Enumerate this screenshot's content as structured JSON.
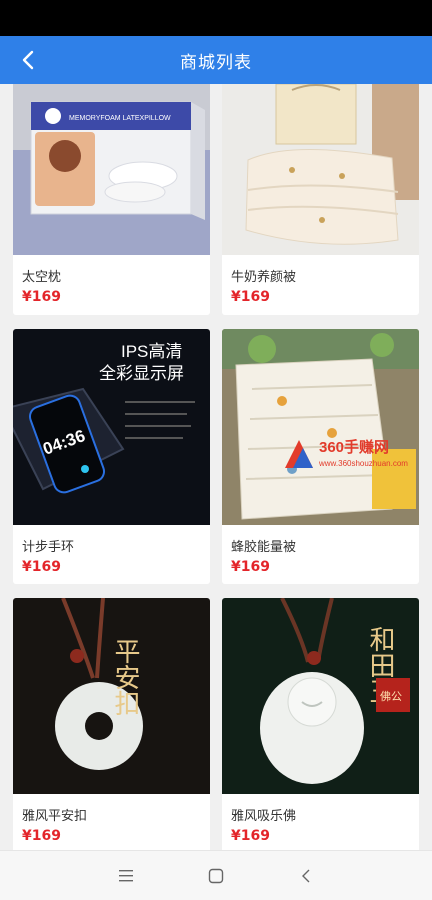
{
  "header": {
    "title": "商城列表"
  },
  "products": [
    {
      "name": "太空枕",
      "price": "¥169"
    },
    {
      "name": "牛奶养颜被",
      "price": "¥169"
    },
    {
      "name": "计步手环",
      "price": "¥169"
    },
    {
      "name": "蜂胶能量被",
      "price": "¥169"
    },
    {
      "name": "雅风平安扣",
      "price": "¥169"
    },
    {
      "name": "雅风吸乐佛",
      "price": "¥169"
    }
  ],
  "images": {
    "pillow_box": {
      "brand": "MEMORYFOAM LATEXPILLOW"
    },
    "band": {
      "headline1": "IPS高清",
      "headline2": "全彩显示屏",
      "time": "04:36"
    },
    "jade1": {
      "chars": "平安扣"
    },
    "jade2": {
      "chars": "和田玉",
      "seal": "佛公"
    }
  },
  "watermark": {
    "text": "360手赚网",
    "url": "www.360shouzhuan.com"
  },
  "colors": {
    "header": "#2f80e8",
    "price": "#e3252a",
    "background": "#f0f0f0"
  },
  "icons": {
    "back": "chevron-left-icon",
    "menu": "menu-icon",
    "home": "home-icon",
    "back_nav": "back-triangle-icon"
  }
}
